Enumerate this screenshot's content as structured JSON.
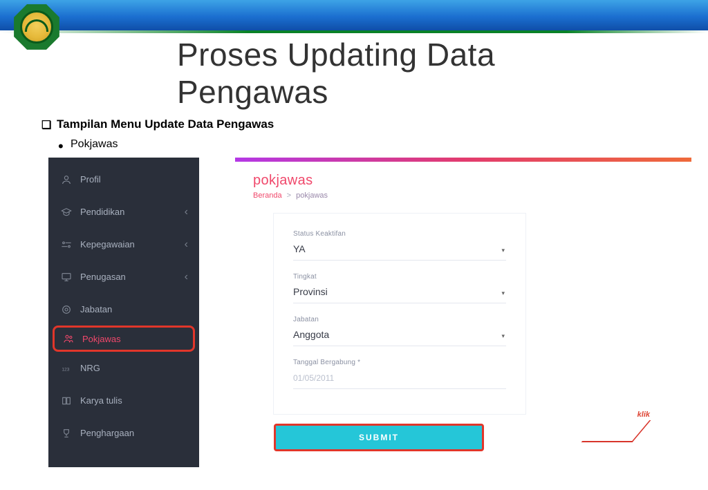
{
  "slide": {
    "title": "Proses Updating Data Pengawas",
    "bullet_heading": "Tampilan Menu Update Data Pengawas",
    "bullet_item": "Pokjawas"
  },
  "sidebar": {
    "items": [
      {
        "label": "Profil",
        "expandable": false
      },
      {
        "label": "Pendidikan",
        "expandable": true
      },
      {
        "label": "Kepegawaian",
        "expandable": true
      },
      {
        "label": "Penugasan",
        "expandable": true
      },
      {
        "label": "Jabatan",
        "expandable": false
      },
      {
        "label": "Pokjawas",
        "expandable": false,
        "active": true
      },
      {
        "label": "NRG",
        "expandable": false
      },
      {
        "label": "Karya tulis",
        "expandable": false
      },
      {
        "label": "Penghargaan",
        "expandable": false
      }
    ]
  },
  "main": {
    "title": "pokjawas",
    "breadcrumb": {
      "home": "Beranda",
      "current": "pokjawas",
      "sep": ">"
    },
    "fields": {
      "status": {
        "label": "Status Keaktifan",
        "value": "YA"
      },
      "tingkat": {
        "label": "Tingkat",
        "value": "Provinsi"
      },
      "jabatan": {
        "label": "Jabatan",
        "value": "Anggota"
      },
      "tanggal": {
        "label": "Tanggal Bergabung *",
        "placeholder": "01/05/2011"
      }
    },
    "submit_label": "SUBMIT",
    "annotation": "klik"
  }
}
